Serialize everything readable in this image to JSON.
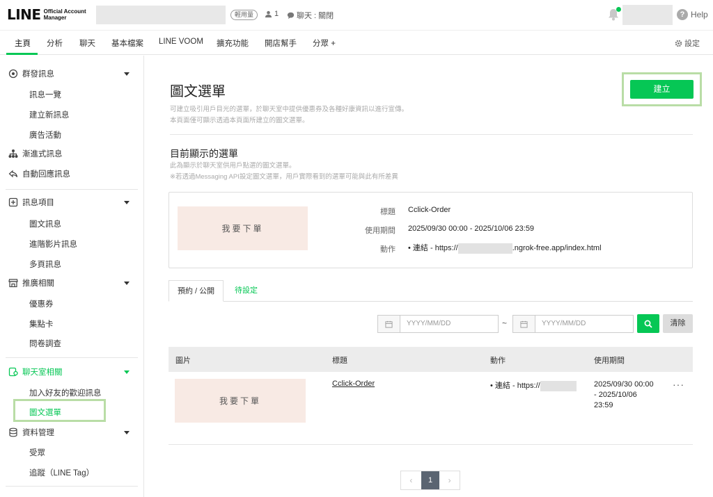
{
  "brand": {
    "logo_big": "LINE",
    "logo_small_1": "Official Account",
    "logo_small_2": "Manager"
  },
  "header": {
    "plan_badge": "輕用量",
    "friends_count": "1",
    "chat_status": "聊天 : 關閉",
    "help": "Help"
  },
  "nav": {
    "tabs": [
      "主頁",
      "分析",
      "聊天",
      "基本檔案",
      "LINE VOOM",
      "擴充功能",
      "開店幫手",
      "分眾 +"
    ],
    "settings": "設定"
  },
  "sidebar": {
    "group_msg": "群發訊息",
    "msg_list": "訊息一覽",
    "new_msg": "建立新訊息",
    "ads": "廣告活動",
    "step_msg": "漸進式訊息",
    "auto_reply": "自動回應訊息",
    "msg_items": "訊息項目",
    "card_msg": "圖文訊息",
    "video_msg": "進階影片訊息",
    "multi_msg": "多頁訊息",
    "promo": "推廣相關",
    "coupon": "優惠券",
    "point_card": "集點卡",
    "survey": "問卷調查",
    "chatroom": "聊天室相關",
    "welcome": "加入好友的歡迎訊息",
    "rich_menu": "圖文選單",
    "data_mgmt": "資料管理",
    "audience": "受眾",
    "tracking": "追蹤（LINE Tag）"
  },
  "page": {
    "title": "圖文選單",
    "desc_1": "可建立吸引用戶目光的選單，於聊天室中提供優惠券及各種好康資訊以進行宣傳。",
    "desc_2": "本頁面僅可顯示透過本頁面所建立的圖文選單。",
    "create_button": "建立"
  },
  "current": {
    "heading": "目前顯示的選單",
    "desc_1": "此為顯示於聊天室供用戶點選的圖文選單。",
    "desc_2": "※若透過Messaging API設定圖文選單，用戶實際看到的選單可能與此有所差異",
    "thumb_text": "我要下單",
    "k_title": "標題",
    "v_title": "Cclick-Order",
    "k_period": "使用期間",
    "v_period": "2025/09/30 00:00 - 2025/10/06 23:59",
    "k_action": "動作",
    "v_action_prefix": "連結 - https://",
    "v_action_suffix": ".ngrok-free.app/index.html"
  },
  "tabs": {
    "published": "預約 / 公開",
    "pending": "待設定"
  },
  "filter": {
    "start_placeholder": "YYYY/MM/DD",
    "end_placeholder": "YYYY/MM/DD",
    "separator": "~",
    "clear": "清除"
  },
  "table": {
    "headers": [
      "圖片",
      "標題",
      "動作",
      "使用期間"
    ],
    "row": {
      "thumb_text": "我要下單",
      "title": "Cclick-Order",
      "action_prefix": "連結 - https://",
      "period_1": "2025/09/30 00:00",
      "period_2": "- 2025/10/06",
      "period_3": "23:59",
      "more": "···"
    }
  },
  "pagination": {
    "current": "1",
    "prev": "‹",
    "next": "›"
  }
}
